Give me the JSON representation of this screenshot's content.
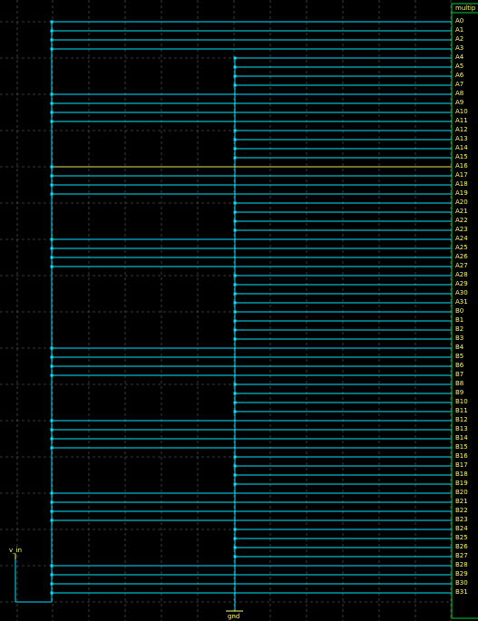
{
  "component": {
    "title": "multipl"
  },
  "pins": [
    "A0",
    "A1",
    "A2",
    "A3",
    "A4",
    "A5",
    "A6",
    "A7",
    "A8",
    "A9",
    "A10",
    "A11",
    "A12",
    "A13",
    "A14",
    "A15",
    "A16",
    "A17",
    "A18",
    "A19",
    "A20",
    "A21",
    "A22",
    "A23",
    "A24",
    "A25",
    "A26",
    "A27",
    "A28",
    "A29",
    "A30",
    "A31",
    "B0",
    "B1",
    "B2",
    "B3",
    "B4",
    "B5",
    "B6",
    "B7",
    "B8",
    "B9",
    "B10",
    "B11",
    "B12",
    "B13",
    "B14",
    "B15",
    "B16",
    "B17",
    "B18",
    "B19",
    "B20",
    "B21",
    "B22",
    "B23",
    "B24",
    "B25",
    "B26",
    "B27",
    "B28",
    "B29",
    "B30",
    "B31"
  ],
  "pin_connections": [
    "v_in",
    "v_in",
    "v_in",
    "v_in",
    "gnd",
    "gnd",
    "gnd",
    "gnd",
    "v_in",
    "v_in",
    "v_in",
    "v_in",
    "gnd",
    "gnd",
    "gnd",
    "gnd",
    "v_in",
    "v_in",
    "v_in",
    "v_in",
    "gnd",
    "gnd",
    "gnd",
    "gnd",
    "v_in",
    "v_in",
    "v_in",
    "v_in",
    "gnd",
    "gnd",
    "gnd",
    "gnd",
    "gnd",
    "gnd",
    "gnd",
    "gnd",
    "v_in",
    "v_in",
    "v_in",
    "v_in",
    "gnd",
    "gnd",
    "gnd",
    "gnd",
    "v_in",
    "v_in",
    "v_in",
    "v_in",
    "gnd",
    "gnd",
    "gnd",
    "gnd",
    "v_in",
    "v_in",
    "v_in",
    "v_in",
    "gnd",
    "gnd",
    "gnd",
    "gnd",
    "v_in",
    "v_in",
    "v_in",
    "v_in"
  ],
  "highlighted_pin": "A16",
  "nets": {
    "vin_label": "v_in",
    "gnd_label": "gnd"
  },
  "colors": {
    "background": "#000000",
    "grid": "#4a4a4a",
    "wire": "#00e5ff",
    "highlight_wire": "#e8e85a",
    "component_border": "#00cc33",
    "label": "#ffff66"
  }
}
